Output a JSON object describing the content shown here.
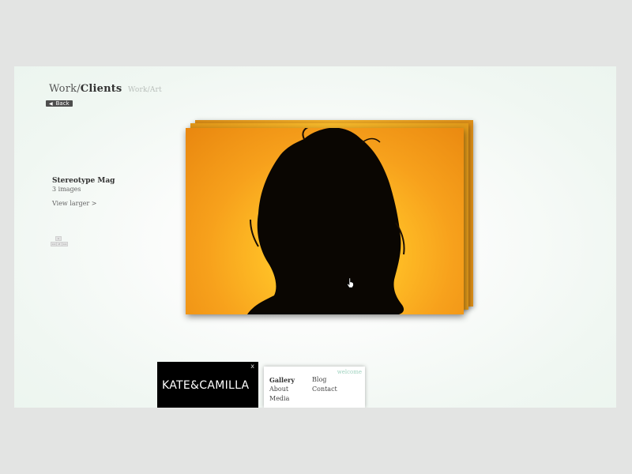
{
  "header": {
    "prefix": "Work/",
    "current": "Clients",
    "alt_link": "Work/Art"
  },
  "back_label": "Back",
  "project": {
    "title": "Stereotype Mag",
    "count": "3 images",
    "view_larger": "View larger >"
  },
  "pager": {
    "top": "1",
    "left": "<<",
    "mid": "2",
    "right": ">>"
  },
  "brand": {
    "logo_text": "KATE&CAMILLA",
    "close": "x"
  },
  "menu": {
    "welcome": "welcome",
    "items": [
      "Gallery",
      "Blog",
      "About",
      "Contact",
      "Media"
    ],
    "active": "Gallery"
  },
  "colors": {
    "page_bg": "#e3e4e3",
    "stage_bg": "#f0f7f2",
    "photo_orange": "#f7a11c",
    "welcome_accent": "#9fd2bf"
  },
  "icons": [
    "back-arrow-icon",
    "close-icon",
    "hand-cursor-icon"
  ]
}
